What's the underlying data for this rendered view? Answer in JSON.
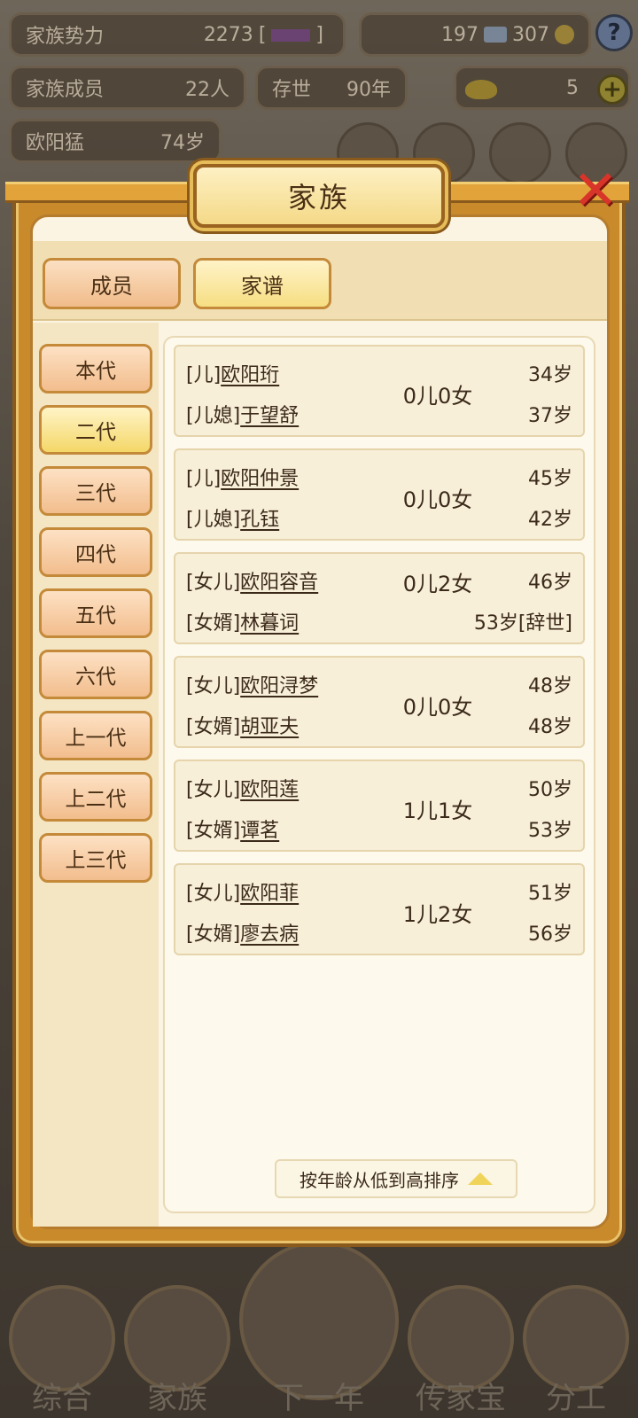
{
  "hud": {
    "power_label": "家族势力",
    "power_value": "2273",
    "power_bracket_open": "[",
    "power_rank": "",
    "power_bracket_close": "]",
    "silver": "197",
    "coins": "307",
    "help": "?",
    "members_label": "家族成员",
    "members_value": "22人",
    "alive_label": "存世",
    "alive_value": "90年",
    "gold": "5",
    "plus": "+",
    "patriarch_name": "欧阳猛",
    "patriarch_age": "74岁"
  },
  "modal": {
    "title": "家族",
    "close": "✕",
    "tabs": [
      {
        "label": "成员",
        "active": false
      },
      {
        "label": "家谱",
        "active": true
      }
    ],
    "generations": [
      {
        "label": "本代",
        "active": false
      },
      {
        "label": "二代",
        "active": true
      },
      {
        "label": "三代",
        "active": false
      },
      {
        "label": "四代",
        "active": false
      },
      {
        "label": "五代",
        "active": false
      },
      {
        "label": "六代",
        "active": false
      },
      {
        "label": "上一代",
        "active": false
      },
      {
        "label": "上二代",
        "active": false
      },
      {
        "label": "上三代",
        "active": false
      }
    ],
    "cards": [
      {
        "r1_tag": "[儿]",
        "r1_name": "欧阳珩",
        "r1_age": "34岁",
        "r2_tag": "[儿媳]",
        "r2_name": "于望舒",
        "r2_age": "37岁",
        "kids": "0儿0女"
      },
      {
        "r1_tag": "[儿]",
        "r1_name": "欧阳仲景",
        "r1_age": "45岁",
        "r2_tag": "[儿媳]",
        "r2_name": "孔钰",
        "r2_age": "42岁",
        "kids": "0儿0女"
      },
      {
        "r1_tag": "[女儿]",
        "r1_name": "欧阳容音",
        "r1_age": "46岁",
        "r2_tag": "[女婿]",
        "r2_name": "林暮词",
        "r2_age": "53岁[辞世]",
        "kids": "0儿2女"
      },
      {
        "r1_tag": "[女儿]",
        "r1_name": "欧阳浔梦",
        "r1_age": "48岁",
        "r2_tag": "[女婿]",
        "r2_name": "胡亚夫",
        "r2_age": "48岁",
        "kids": "0儿0女"
      },
      {
        "r1_tag": "[女儿]",
        "r1_name": "欧阳莲",
        "r1_age": "50岁",
        "r2_tag": "[女婿]",
        "r2_name": "谭茗",
        "r2_age": "53岁",
        "kids": "1儿1女"
      },
      {
        "r1_tag": "[女儿]",
        "r1_name": "欧阳菲",
        "r1_age": "51岁",
        "r2_tag": "[女婿]",
        "r2_name": "廖去病",
        "r2_age": "56岁",
        "kids": "1儿2女"
      }
    ],
    "sort_label": "按年龄从低到高排序"
  },
  "bottom_nav": [
    {
      "label": "综合"
    },
    {
      "label": "家族"
    },
    {
      "label": "下一年"
    },
    {
      "label": "传家宝"
    },
    {
      "label": "分工"
    }
  ],
  "colors": {
    "accent_gold": "#c98a2c",
    "panel_bg": "#fbf4e2",
    "close_red": "#d8342a"
  }
}
